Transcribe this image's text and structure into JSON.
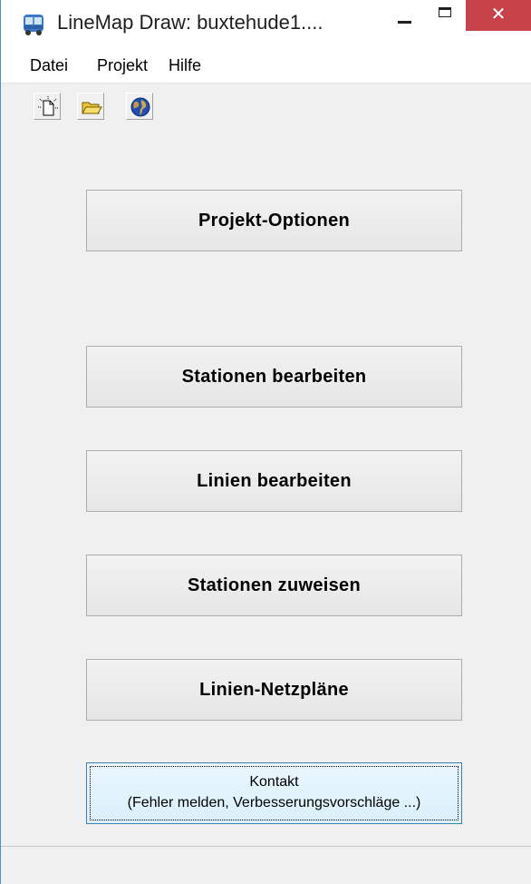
{
  "window": {
    "title": "LineMap Draw: buxtehude1....",
    "close_glyph": "✕"
  },
  "menu": {
    "items": [
      "Datei",
      "Projekt",
      "Hilfe"
    ]
  },
  "toolbar": {
    "icons": [
      "new-file-icon",
      "open-folder-icon",
      "globe-icon"
    ]
  },
  "main": {
    "buttons": [
      "Projekt-Optionen",
      "Stationen bearbeiten",
      "Linien bearbeiten",
      "Stationen zuweisen",
      "Linien-Netzpläne"
    ],
    "contact": {
      "line1": "Kontakt",
      "line2": "(Fehler melden, Verbesserungsvorschläge ...)"
    }
  },
  "colors": {
    "window_border": "#4a90d6",
    "close_button": "#c8424a",
    "focused_button_border": "#3c7fb1",
    "background": "#f0f0f0"
  }
}
